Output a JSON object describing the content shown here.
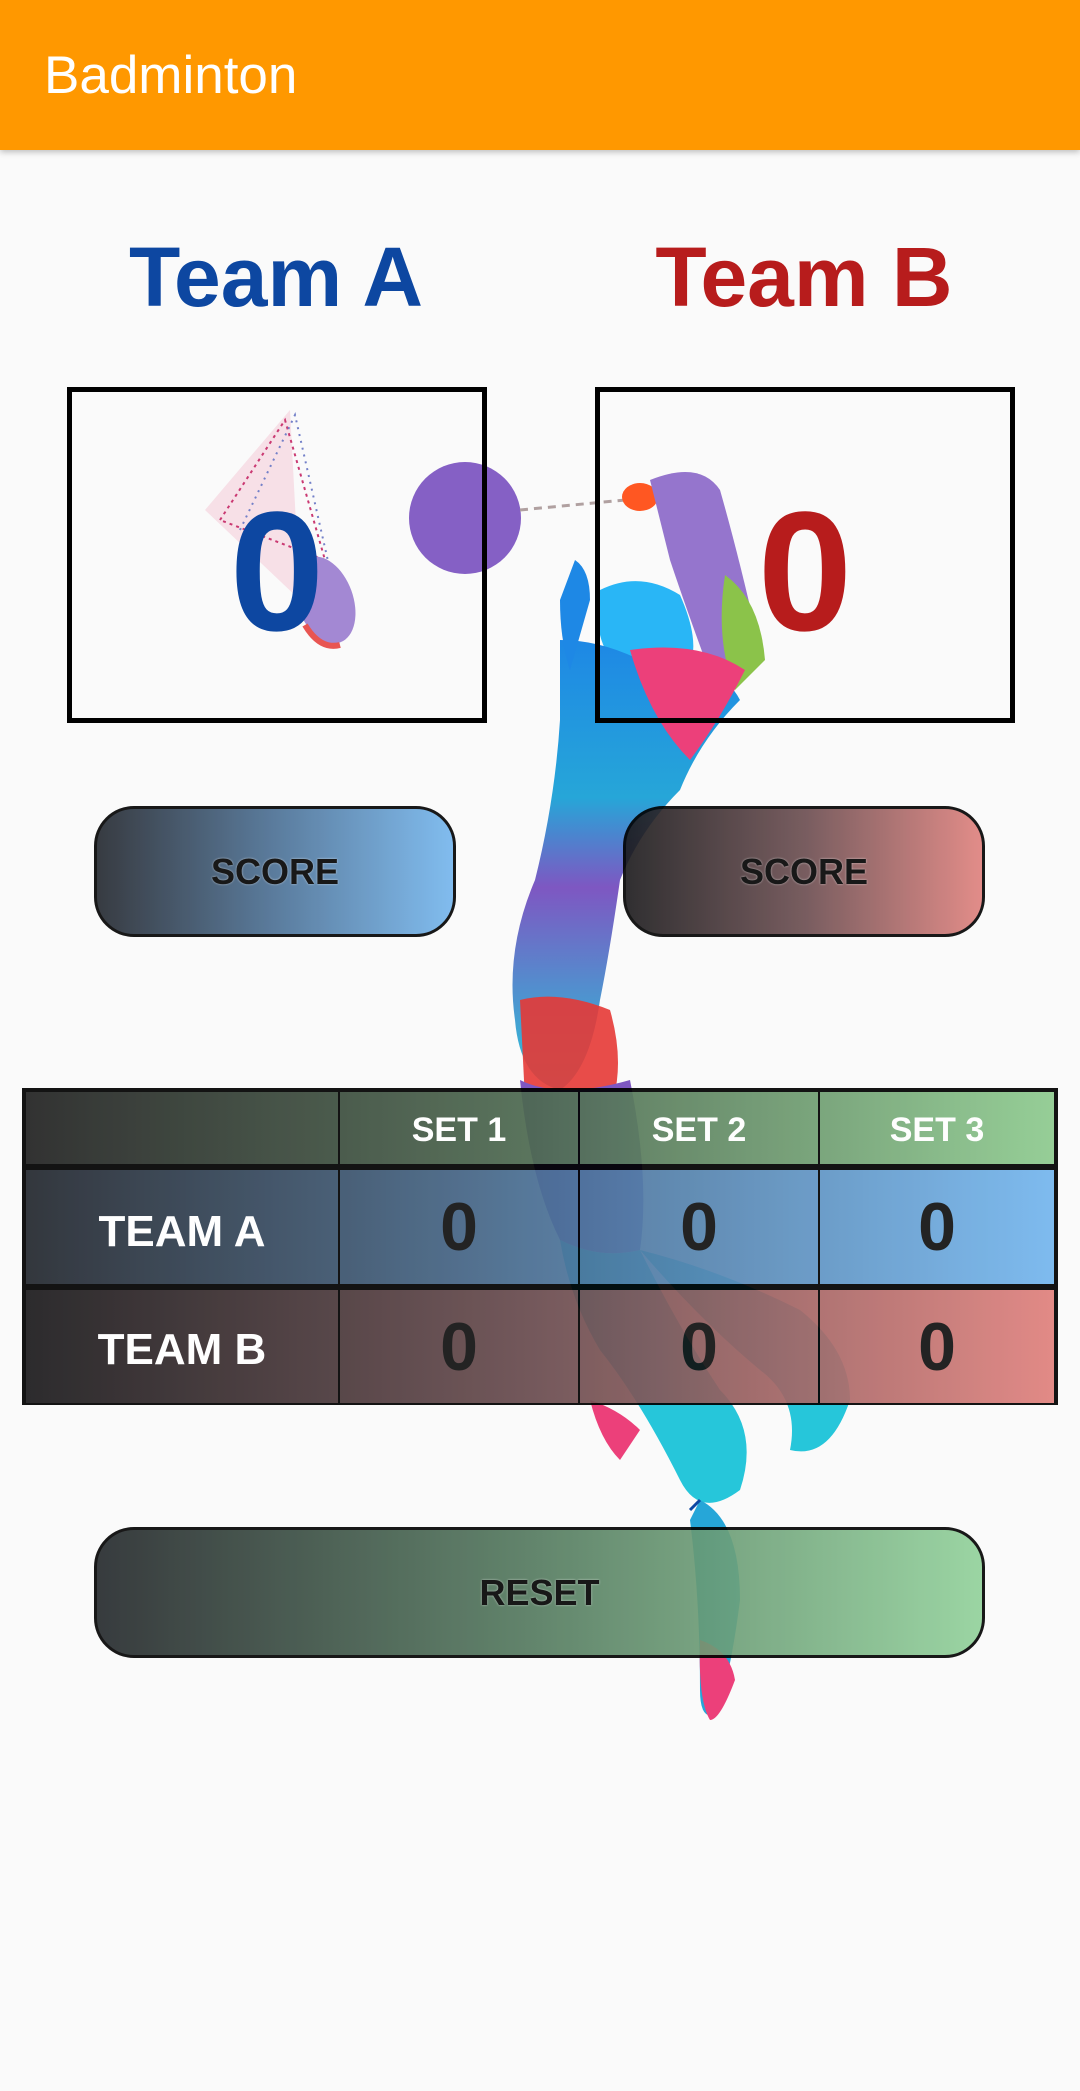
{
  "app_bar": {
    "title": "Badminton",
    "color": "#ff9800"
  },
  "team_a": {
    "name": "Team A",
    "score": "0",
    "score_button": "SCORE",
    "color": "#0d47a1"
  },
  "team_b": {
    "name": "Team B",
    "score": "0",
    "score_button": "SCORE",
    "color": "#b71c1c"
  },
  "sets_table": {
    "headers": [
      "",
      "SET 1",
      "SET 2",
      "SET 3"
    ],
    "rows": [
      {
        "label": "TEAM A",
        "values": [
          "0",
          "0",
          "0"
        ]
      },
      {
        "label": "TEAM B",
        "values": [
          "0",
          "0",
          "0"
        ]
      }
    ]
  },
  "reset_button": "RESET",
  "background_image": "badminton-player-silhouette"
}
